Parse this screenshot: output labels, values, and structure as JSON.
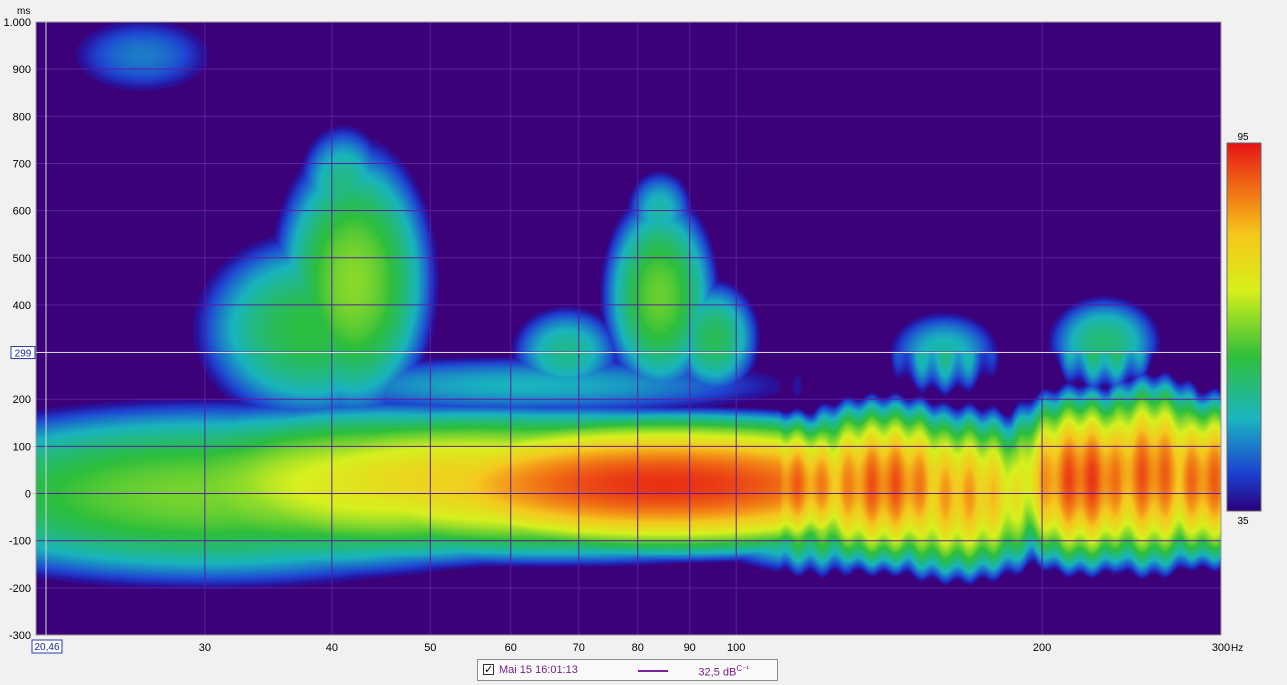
{
  "colors": {
    "background": "#3c0078",
    "grid": "#5a1fa0",
    "cursor": "#d8d8d8",
    "tick_text": "#000000",
    "legend_line": "#7b1fa2"
  },
  "chart_data": {
    "type": "heatmap",
    "title": "",
    "x_unit": "Hz",
    "y_unit": "ms",
    "x_scale": "log",
    "xlim": [
      20.46,
      300
    ],
    "ylim": [
      -300,
      1000
    ],
    "x_ticks": [
      30,
      40,
      50,
      60,
      70,
      80,
      90,
      100,
      200,
      300
    ],
    "x_tick_labels": [
      "30",
      "40",
      "50",
      "60",
      "70",
      "80",
      "90",
      "100",
      "200",
      "300"
    ],
    "y_ticks": [
      -300,
      -200,
      -100,
      0,
      100,
      200,
      300,
      400,
      500,
      600,
      700,
      800,
      900,
      1000
    ],
    "y_tick_labels": [
      "-300",
      "-200",
      "-100",
      "0",
      "100",
      "200",
      "",
      "400",
      "500",
      "600",
      "700",
      "800",
      "900",
      "1.000"
    ],
    "grid": true,
    "color_scale": {
      "min": 35,
      "max": 95,
      "min_label": "35",
      "max_label": "95"
    },
    "cursor": {
      "x_label": "20,46",
      "y_label": "299",
      "x": 20.46,
      "y": 299
    },
    "series": [
      {
        "name": "Mai 15 16:01:13",
        "blobs": [
          {
            "f": 85,
            "t": 20,
            "wf": 0.3,
            "wt": 130,
            "level": 93
          },
          {
            "f": 66,
            "t": 20,
            "wf": 0.35,
            "wt": 140,
            "level": 80
          },
          {
            "f": 55,
            "t": 30,
            "wf": 0.3,
            "wt": 135,
            "level": 78
          },
          {
            "f": 45,
            "t": 20,
            "wf": 0.25,
            "wt": 150,
            "level": 74
          },
          {
            "f": 38,
            "t": 10,
            "wf": 0.25,
            "wt": 160,
            "level": 68
          },
          {
            "f": 30,
            "t": 0,
            "wf": 0.3,
            "wt": 170,
            "level": 65
          },
          {
            "f": 24,
            "t": 0,
            "wf": 0.25,
            "wt": 110,
            "level": 58
          },
          {
            "f": 140,
            "t": 20,
            "wf": 0.1,
            "wt": 150,
            "level": 88
          },
          {
            "f": 165,
            "t": 0,
            "wf": 0.1,
            "wt": 150,
            "level": 82
          },
          {
            "f": 220,
            "t": 30,
            "wf": 0.08,
            "wt": 160,
            "level": 90
          },
          {
            "f": 255,
            "t": 40,
            "wf": 0.07,
            "wt": 170,
            "level": 88
          },
          {
            "f": 290,
            "t": 30,
            "wf": 0.07,
            "wt": 150,
            "level": 87
          },
          {
            "f": 120,
            "t": 0,
            "wf": 0.12,
            "wt": 140,
            "level": 72
          },
          {
            "f": 42,
            "t": 450,
            "wf": 0.07,
            "wt": 260,
            "level": 66
          },
          {
            "f": 38,
            "t": 350,
            "wf": 0.1,
            "wt": 180,
            "level": 60
          },
          {
            "f": 41,
            "t": 650,
            "wf": 0.04,
            "wt": 120,
            "level": 55
          },
          {
            "f": 84,
            "t": 420,
            "wf": 0.05,
            "wt": 190,
            "level": 64
          },
          {
            "f": 84,
            "t": 600,
            "wf": 0.03,
            "wt": 80,
            "level": 52
          },
          {
            "f": 95,
            "t": 330,
            "wf": 0.04,
            "wt": 110,
            "level": 58
          },
          {
            "f": 68,
            "t": 300,
            "wf": 0.05,
            "wt": 90,
            "level": 54
          },
          {
            "f": 26,
            "t": 930,
            "wf": 0.07,
            "wt": 80,
            "level": 46
          },
          {
            "f": 62,
            "t": 230,
            "wf": 0.25,
            "wt": 60,
            "level": 50
          },
          {
            "f": 230,
            "t": 320,
            "wf": 0.05,
            "wt": 90,
            "level": 56
          },
          {
            "f": 160,
            "t": 300,
            "wf": 0.05,
            "wt": 80,
            "level": 52
          }
        ],
        "legend_value": "32,5 dB",
        "legend_sup": "C⁻¹"
      }
    ],
    "legend": "bottom-center"
  }
}
